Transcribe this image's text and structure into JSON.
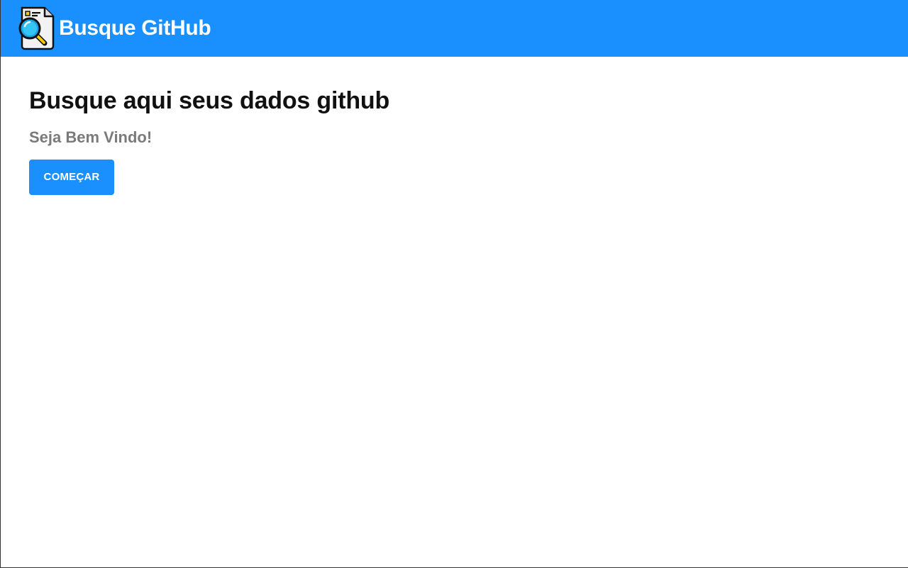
{
  "header": {
    "logo_icon": "document-search-icon",
    "title": "Busque GitHub",
    "background_color": "#1a90ff"
  },
  "main": {
    "heading": "Busque aqui seus dados github",
    "subheading": "Seja Bem Vindo!",
    "start_button_label": "COMEÇAR",
    "accent_color": "#1a90ff"
  }
}
